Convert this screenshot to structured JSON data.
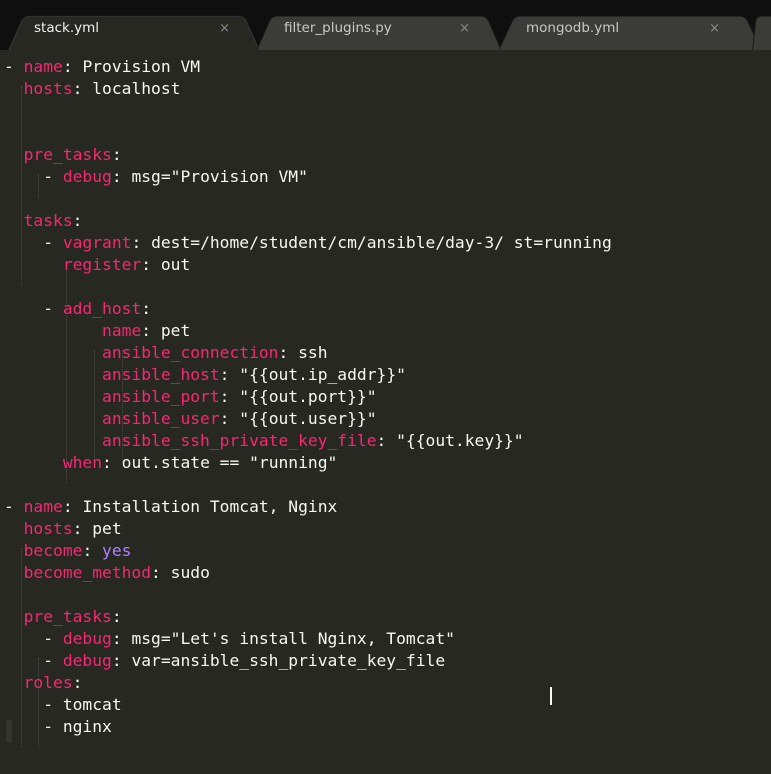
{
  "tabs": [
    {
      "label": "stack.yml",
      "close": "×",
      "active": true
    },
    {
      "label": "filter_plugins.py",
      "close": "×",
      "active": false
    },
    {
      "label": "mongodb.yml",
      "close": "×",
      "active": false
    }
  ],
  "code": [
    {
      "indent": "",
      "dash": "- ",
      "key": "name",
      "sep": ": ",
      "value": "Provision VM"
    },
    {
      "indent": "  ",
      "dash": "",
      "key": "hosts",
      "sep": ": ",
      "value": "localhost"
    },
    {
      "indent": "",
      "dash": "",
      "key": "",
      "sep": "",
      "value": ""
    },
    {
      "indent": "",
      "dash": "",
      "key": "",
      "sep": "",
      "value": ""
    },
    {
      "indent": "  ",
      "dash": "",
      "key": "pre_tasks",
      "sep": ":",
      "value": ""
    },
    {
      "indent": "    ",
      "dash": "- ",
      "key": "debug",
      "sep": ": ",
      "value": "msg=\"Provision VM\""
    },
    {
      "indent": "",
      "dash": "",
      "key": "",
      "sep": "",
      "value": ""
    },
    {
      "indent": "  ",
      "dash": "",
      "key": "tasks",
      "sep": ":",
      "value": ""
    },
    {
      "indent": "    ",
      "dash": "- ",
      "key": "vagrant",
      "sep": ": ",
      "value": "dest=/home/student/cm/ansible/day-3/ st=running"
    },
    {
      "indent": "      ",
      "dash": "",
      "key": "register",
      "sep": ": ",
      "value": "out"
    },
    {
      "indent": "",
      "dash": "",
      "key": "",
      "sep": "",
      "value": ""
    },
    {
      "indent": "    ",
      "dash": "- ",
      "key": "add_host",
      "sep": ":",
      "value": ""
    },
    {
      "indent": "          ",
      "dash": "",
      "key": "name",
      "sep": ": ",
      "value": "pet"
    },
    {
      "indent": "          ",
      "dash": "",
      "key": "ansible_connection",
      "sep": ": ",
      "value": "ssh"
    },
    {
      "indent": "          ",
      "dash": "",
      "key": "ansible_host",
      "sep": ": ",
      "value": "\"{{out.ip_addr}}\""
    },
    {
      "indent": "          ",
      "dash": "",
      "key": "ansible_port",
      "sep": ": ",
      "value": "\"{{out.port}}\""
    },
    {
      "indent": "          ",
      "dash": "",
      "key": "ansible_user",
      "sep": ": ",
      "value": "\"{{out.user}}\""
    },
    {
      "indent": "          ",
      "dash": "",
      "key": "ansible_ssh_private_key_file",
      "sep": ": ",
      "value": "\"{{out.key}}\""
    },
    {
      "indent": "      ",
      "dash": "",
      "key": "when",
      "sep": ": ",
      "value": "out.state == \"running\""
    },
    {
      "indent": "",
      "dash": "",
      "key": "",
      "sep": "",
      "value": ""
    },
    {
      "indent": "",
      "dash": "- ",
      "key": "name",
      "sep": ": ",
      "value": "Installation Tomcat, Nginx"
    },
    {
      "indent": "  ",
      "dash": "",
      "key": "hosts",
      "sep": ": ",
      "value": "pet"
    },
    {
      "indent": "  ",
      "dash": "",
      "key": "become",
      "sep": ": ",
      "value": "yes",
      "valueClass": "n"
    },
    {
      "indent": "  ",
      "dash": "",
      "key": "become_method",
      "sep": ": ",
      "value": "sudo"
    },
    {
      "indent": "",
      "dash": "",
      "key": "",
      "sep": "",
      "value": ""
    },
    {
      "indent": "  ",
      "dash": "",
      "key": "pre_tasks",
      "sep": ":",
      "value": ""
    },
    {
      "indent": "    ",
      "dash": "- ",
      "key": "debug",
      "sep": ": ",
      "value": "msg=\"Let's install Nginx, Tomcat\""
    },
    {
      "indent": "    ",
      "dash": "- ",
      "key": "debug",
      "sep": ": ",
      "value": "var=ansible_ssh_private_key_file"
    },
    {
      "indent": "  ",
      "dash": "",
      "key": "roles",
      "sep": ":",
      "value": ""
    },
    {
      "indent": "    ",
      "dash": "- ",
      "key": "",
      "sep": "",
      "value": "tomcat"
    },
    {
      "indent": "    ",
      "dash": "- ",
      "key": "",
      "sep": "",
      "value": "nginx"
    }
  ],
  "colors": {
    "background": "#272822",
    "key": "#f92672",
    "text": "#f8f8f2",
    "constant": "#ae81ff"
  }
}
